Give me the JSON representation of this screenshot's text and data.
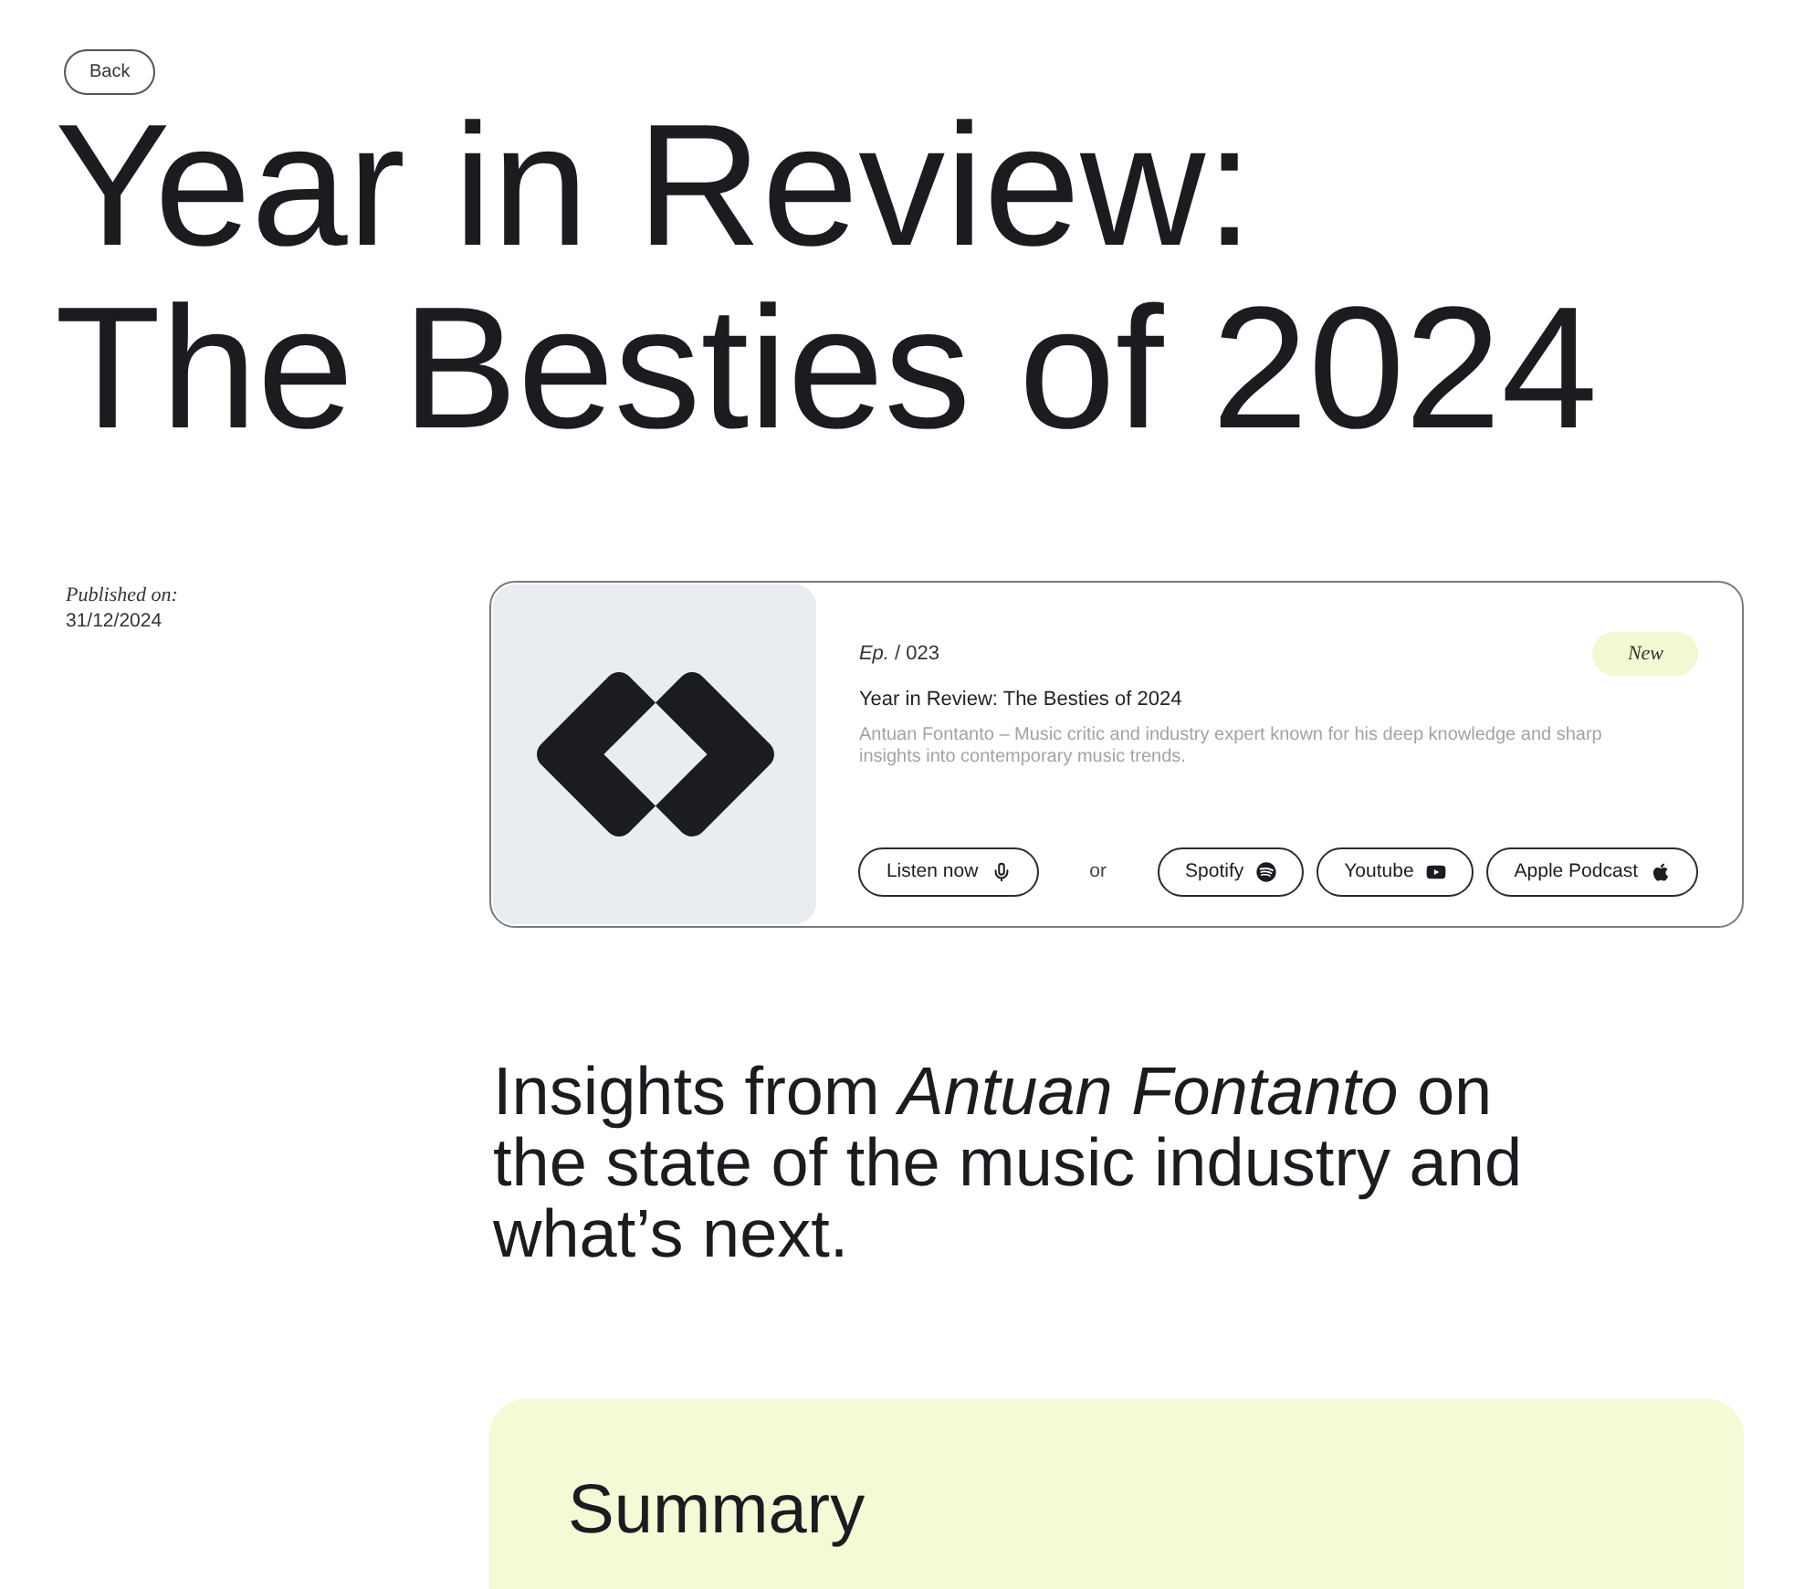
{
  "back_button": {
    "label": "Back"
  },
  "title": "Year in Review:\nThe Besties of 2024",
  "published": {
    "label": "Published on:",
    "date": "31/12/2024"
  },
  "episode_card": {
    "episode": "*Ep.* / 023",
    "badge": "New",
    "title": "Year in Review: The Besties of 2024",
    "description": "Antuan Fontanto – Music critic and industry expert known for his deep knowledge and sharp insights into contemporary music trends.",
    "listen_button": {
      "label": "Listen now",
      "kind": "microphone"
    },
    "separator": "or",
    "platforms": [
      {
        "label": "Spotify",
        "kind": "spotify"
      },
      {
        "label": "Youtube",
        "kind": "youtube"
      },
      {
        "label": "Apple Podcast",
        "kind": "apple"
      }
    ]
  },
  "insight_heading": "Insights from *Antuan Fontanto* on the state of the music industry and what’s next.",
  "summary": {
    "title": "Summary"
  }
}
